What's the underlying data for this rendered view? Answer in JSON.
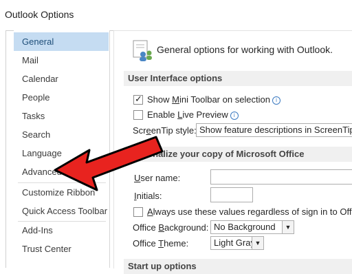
{
  "window": {
    "title": "Outlook Options"
  },
  "nav": {
    "items": [
      {
        "label": "General",
        "selected": true
      },
      {
        "label": "Mail"
      },
      {
        "label": "Calendar"
      },
      {
        "label": "People"
      },
      {
        "label": "Tasks"
      },
      {
        "label": "Search"
      },
      {
        "label": "Language"
      },
      {
        "label": "Advanced"
      },
      {
        "label": "Customize Ribbon"
      },
      {
        "label": "Quick Access Toolbar"
      },
      {
        "label": "Add-Ins"
      },
      {
        "label": "Trust Center"
      }
    ]
  },
  "pane": {
    "heading": "General options for working with Outlook.",
    "sections": {
      "ui": "User Interface options",
      "personalize": "Personalize your copy of Microsoft Office",
      "startup": "Start up options"
    },
    "mini_toolbar": {
      "label_pre": "Show ",
      "label_u": "M",
      "label_post": "ini Toolbar on selection",
      "checked": true
    },
    "live_preview": {
      "label_pre": "Enable ",
      "label_u": "L",
      "label_post": "ive Preview",
      "checked": false
    },
    "screentip": {
      "label_pre": "Scr",
      "label_u": "e",
      "label_post": "enTip style:",
      "value": "Show feature descriptions in ScreenTips"
    },
    "user_name": {
      "label_u": "U",
      "label_post": "ser name:",
      "value": ""
    },
    "initials": {
      "label_u": "I",
      "label_post": "nitials:",
      "value": ""
    },
    "always_use": {
      "label_u": "A",
      "label_post": "lways use these values regardless of sign in to Office.",
      "checked": false
    },
    "office_background": {
      "label_pre": "Office ",
      "label_u": "B",
      "label_post": "ackground:",
      "value": "No Background"
    },
    "office_theme": {
      "label_pre": "Office ",
      "label_u": "T",
      "label_post": "heme:",
      "value": "Light Gray"
    },
    "info_glyph": "i"
  },
  "colors": {
    "selected_bg": "#c5dcf2",
    "arrow": "#e8231f",
    "section_bg": "#f0f0f0"
  }
}
